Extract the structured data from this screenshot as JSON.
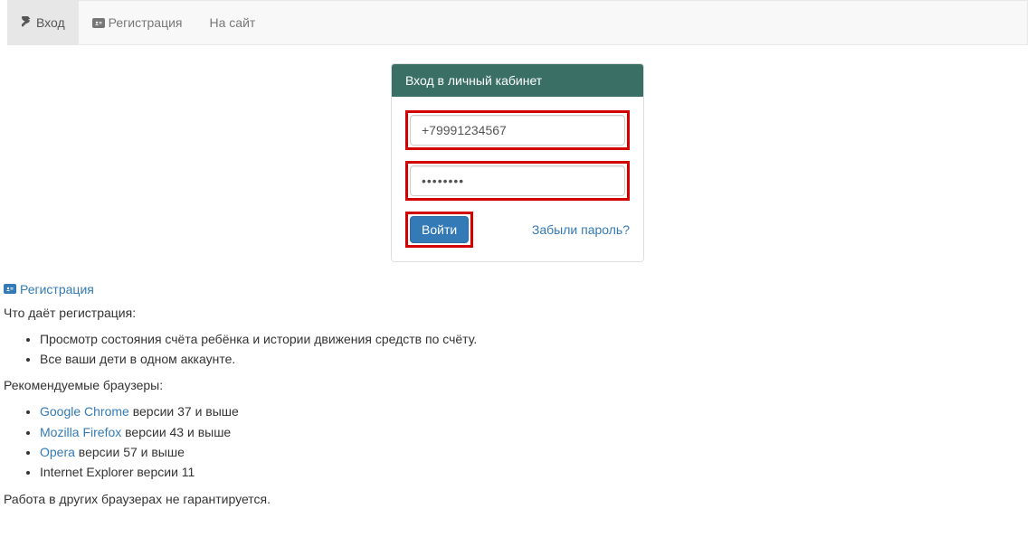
{
  "nav": {
    "login": "Вход",
    "register": "Регистрация",
    "site": "На сайт"
  },
  "login_form": {
    "title": "Вход в личный кабинет",
    "phone_value": "+79991234567",
    "password_value": "••••••••",
    "submit": "Войти",
    "forgot": "Забыли пароль?"
  },
  "reg_link": "Регистрация",
  "info": {
    "what_gives": "Что даёт регистрация:",
    "bullets_reg": [
      "Просмотр состояния счёта ребёнка и истории движения средств по счёту.",
      "Все ваши дети в одном аккаунте."
    ],
    "rec_browsers": "Рекомендуемые браузеры:",
    "browsers": [
      {
        "name": "Google Chrome",
        "suffix": " версии 37 и выше",
        "link": true
      },
      {
        "name": "Mozilla Firefox",
        "suffix": " версии 43 и выше",
        "link": true
      },
      {
        "name": "Opera",
        "suffix": " версии 57 и выше",
        "link": true
      },
      {
        "name": "Internet Explorer",
        "suffix": " версии 11",
        "link": false
      }
    ],
    "disclaimer": "Работа в других браузерах не гарантируется."
  }
}
